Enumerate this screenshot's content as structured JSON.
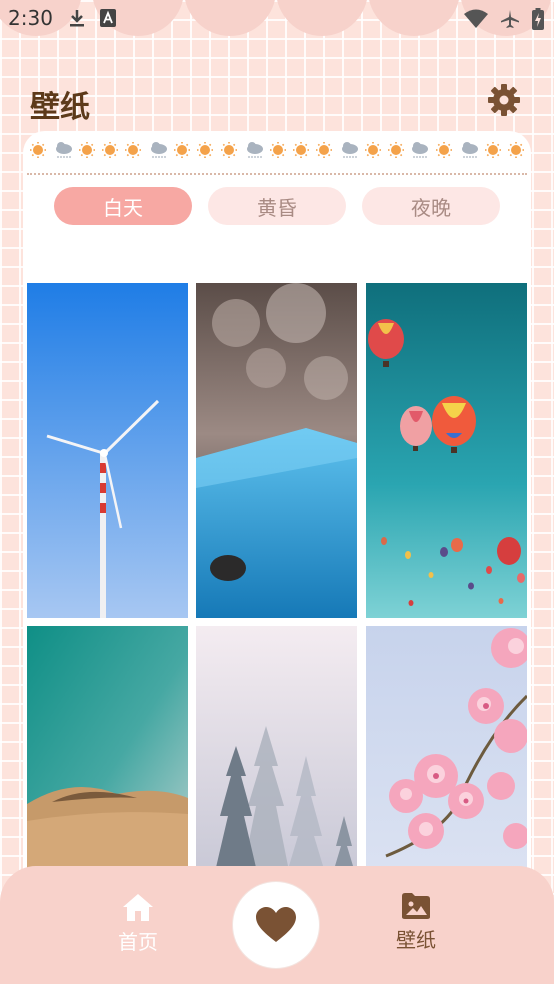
{
  "status_bar": {
    "time": "2:30"
  },
  "header": {
    "title": "壁纸"
  },
  "tabs": [
    {
      "label": "白天",
      "active": true
    },
    {
      "label": "黄昏",
      "active": false
    },
    {
      "label": "夜晚",
      "active": false
    }
  ],
  "wallpapers": [
    {
      "subject": "wind-turbine"
    },
    {
      "subject": "water-droplets"
    },
    {
      "subject": "hot-air-balloons"
    },
    {
      "subject": "desert-dunes"
    },
    {
      "subject": "misty-forest"
    },
    {
      "subject": "cherry-blossoms"
    }
  ],
  "nav": {
    "home_label": "首页",
    "wallpaper_label": "壁纸"
  },
  "colors": {
    "accent": "#f7a8a3",
    "brown": "#7a5234",
    "nav_bg": "#f8d2cb"
  }
}
